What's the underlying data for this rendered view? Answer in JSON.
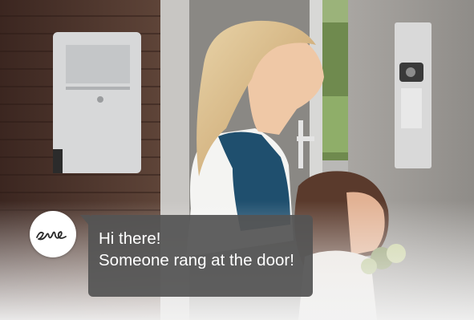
{
  "notification": {
    "avatar_icon": "eve-logo-icon",
    "logo_text": "eve",
    "lines": [
      "Hi there!",
      "Someone rang at the door!"
    ]
  },
  "colors": {
    "bubble": "#545454",
    "bubble_text": "#ffffff",
    "avatar_bg": "#ffffff"
  }
}
